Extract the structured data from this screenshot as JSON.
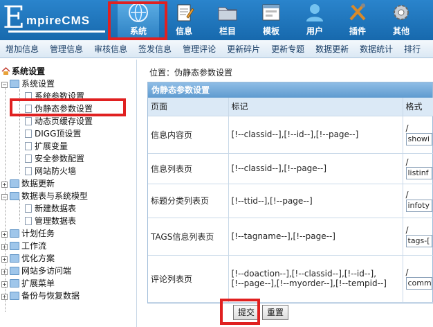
{
  "brand": {
    "big": "E",
    "rest": "mpireCMS"
  },
  "nav": [
    {
      "label": "系统",
      "icon": "system-globe-icon",
      "active": true
    },
    {
      "label": "信息",
      "icon": "notepad-icon"
    },
    {
      "label": "栏目",
      "icon": "folder-icon"
    },
    {
      "label": "模板",
      "icon": "template-window-icon"
    },
    {
      "label": "用户",
      "icon": "user-icon"
    },
    {
      "label": "插件",
      "icon": "plugin-tools-icon"
    },
    {
      "label": "其他",
      "icon": "gear-icon"
    }
  ],
  "submenu": [
    "增加信息",
    "管理信息",
    "审核信息",
    "签发信息",
    "管理评论",
    "更新碎片",
    "更新专题",
    "数据更新",
    "数据统计",
    "排行"
  ],
  "tree": {
    "root": "系统设置",
    "items": [
      "系统设置",
      "系统参数设置",
      "伪静态参数设置",
      "动态页缓存设置",
      "DIGG顶设置",
      "扩展变量",
      "安全参数配置",
      "网站防火墙",
      "数据更新",
      "数据表与系统模型",
      "新建数据表",
      "管理数据表",
      "计划任务",
      "工作流",
      "优化方案",
      "网站多访问端",
      "扩展菜单",
      "备份与恢复数据"
    ]
  },
  "location": "位置：伪静态参数设置",
  "panel": {
    "title": "伪静态参数设置",
    "headers": [
      "页面",
      "标记",
      "格式"
    ],
    "rows": [
      {
        "page": "信息内容页",
        "mark": "[!--classid--],[!--id--],[!--page--]",
        "format": "showi"
      },
      {
        "page": "信息列表页",
        "mark": "[!--classid--],[!--page--]",
        "format": "listinf"
      },
      {
        "page": "标题分类列表页",
        "mark": "[!--ttid--],[!--page--]",
        "format": "infoty"
      },
      {
        "page": "TAGS信息列表页",
        "mark": "[!--tagname--],[!--page--]",
        "format": "tags-["
      },
      {
        "page": "评论列表页",
        "mark1": "[!--doaction--],[!--classid--],[!--id--],",
        "mark2": "[!--page--],[!--myorder--],[!--tempid--]",
        "format": "comm"
      }
    ],
    "slash": "/"
  },
  "buttons": {
    "submit": "提交",
    "reset": "重置"
  },
  "colors": {
    "header": "#1f77bf",
    "highlight": "#e02020"
  }
}
